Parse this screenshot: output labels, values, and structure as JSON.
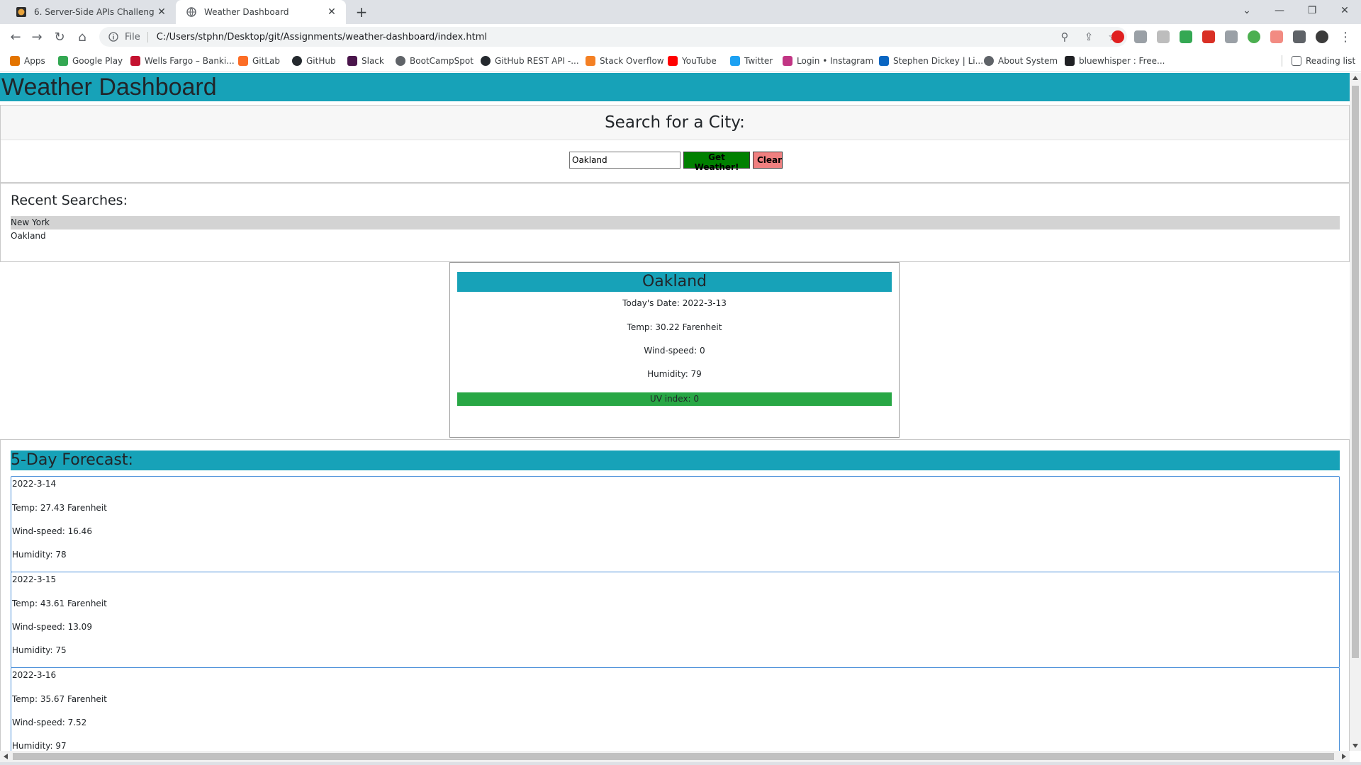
{
  "browser": {
    "tabs": [
      {
        "title": "6. Server-Side APIs Challenge: W",
        "active": false
      },
      {
        "title": "Weather Dashboard",
        "active": true
      }
    ],
    "scheme": "File",
    "url": "C:/Users/stphn/Desktop/git/Assignments/weather-dashboard/index.html",
    "bookmarks": [
      {
        "label": "Apps",
        "icon": "apps-grid-icon"
      },
      {
        "label": "Google Play",
        "icon": "google-play-icon"
      },
      {
        "label": "Wells Fargo – Banki...",
        "icon": "wells-fargo-icon"
      },
      {
        "label": "GitLab",
        "icon": "gitlab-icon"
      },
      {
        "label": "GitHub",
        "icon": "github-icon"
      },
      {
        "label": "Slack",
        "icon": "slack-icon"
      },
      {
        "label": "BootCampSpot",
        "icon": "globe-icon"
      },
      {
        "label": "GitHub REST API -...",
        "icon": "github-icon"
      },
      {
        "label": "Stack Overflow",
        "icon": "stack-overflow-icon"
      },
      {
        "label": "YouTube",
        "icon": "youtube-icon"
      },
      {
        "label": "Twitter",
        "icon": "twitter-icon"
      },
      {
        "label": "Login • Instagram",
        "icon": "instagram-icon"
      },
      {
        "label": "Stephen Dickey | Li...",
        "icon": "linkedin-icon"
      },
      {
        "label": "About System",
        "icon": "globe-icon"
      },
      {
        "label": "bluewhisper : Free...",
        "icon": "bluewhisper-icon"
      }
    ],
    "reading_list": "Reading list"
  },
  "page": {
    "title": "Weather Dashboard",
    "search": {
      "heading": "Search for a City:",
      "value": "Oakland",
      "get_label": "Get Weather!",
      "clear_label": "Clear"
    },
    "recent": {
      "heading": "Recent Searches:",
      "items": [
        "New York",
        "Oakland"
      ]
    },
    "current": {
      "city": "Oakland",
      "date": "Today's Date: 2022-3-13",
      "temp": "Temp: 30.22 Farenheit",
      "wind": "Wind-speed: 0",
      "humidity": "Humidity: 79",
      "uv": "UV index: 0"
    },
    "forecast": {
      "heading": "5-Day Forecast:",
      "days": [
        {
          "date": "2022-3-14",
          "temp": "Temp: 27.43 Farenheit",
          "wind": "Wind-speed: 16.46",
          "humidity": "Humidity: 78"
        },
        {
          "date": "2022-3-15",
          "temp": "Temp: 43.61 Farenheit",
          "wind": "Wind-speed: 13.09",
          "humidity": "Humidity: 75"
        },
        {
          "date": "2022-3-16",
          "temp": "Temp: 35.67 Farenheit",
          "wind": "Wind-speed: 7.52",
          "humidity": "Humidity: 97"
        }
      ]
    }
  },
  "colors": {
    "header": "#17a2b8",
    "get_button": "#008000",
    "clear_button": "#f08080",
    "uv_low": "#28a745",
    "recent_highlight": "#d3d3d3"
  }
}
